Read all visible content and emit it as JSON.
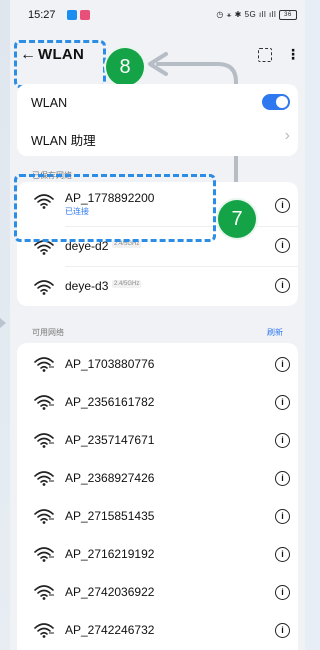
{
  "status_bar": {
    "time": "15:27",
    "indicators": "◷ ⚹ ✱ 5G",
    "signal": "ıll ıll",
    "battery": "36"
  },
  "header": {
    "back_label": "←",
    "title": "WLAN",
    "more_label": "⋮"
  },
  "badges": {
    "b8": "8",
    "b7": "7"
  },
  "settings": {
    "wlan_label": "WLAN",
    "wlan_on": true,
    "assistant_label": "WLAN 助理",
    "assistant_chevron": "›"
  },
  "saved_section": {
    "label": "已保存网络",
    "networks": [
      {
        "name": "AP_1778892200",
        "status": "已连接",
        "band": ""
      },
      {
        "name": "deye-d2",
        "status": "",
        "band": "2.4/5GHz"
      },
      {
        "name": "deye-d3",
        "status": "",
        "band": "2.4/5GHz"
      }
    ]
  },
  "available_section": {
    "label": "可用网络",
    "refresh": "刷新",
    "networks": [
      {
        "name": "AP_1703880776"
      },
      {
        "name": "AP_2356161782"
      },
      {
        "name": "AP_2357147671"
      },
      {
        "name": "AP_2368927426"
      },
      {
        "name": "AP_2715851435"
      },
      {
        "name": "AP_2716219192"
      },
      {
        "name": "AP_2742036922"
      },
      {
        "name": "AP_2742246732"
      }
    ]
  },
  "info_symbol": "i",
  "colors": {
    "accent": "#2f78f0",
    "badge": "#14a447",
    "dashes": "#2b8de6"
  }
}
